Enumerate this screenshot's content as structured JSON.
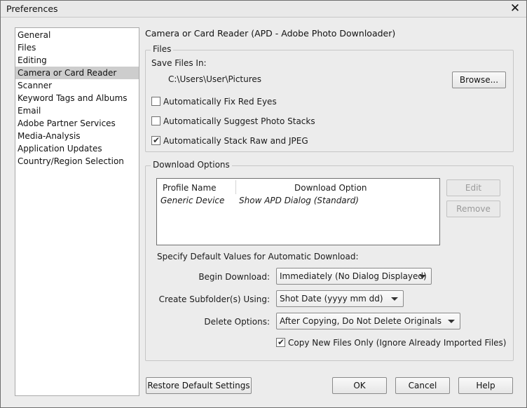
{
  "window": {
    "title": "Preferences"
  },
  "sidebar": {
    "items": [
      {
        "label": "General"
      },
      {
        "label": "Files"
      },
      {
        "label": "Editing"
      },
      {
        "label": "Camera or Card Reader",
        "selected": true
      },
      {
        "label": "Scanner"
      },
      {
        "label": "Keyword Tags and Albums"
      },
      {
        "label": "Email"
      },
      {
        "label": "Adobe Partner Services"
      },
      {
        "label": "Media-Analysis"
      },
      {
        "label": "Application Updates"
      },
      {
        "label": "Country/Region Selection"
      }
    ]
  },
  "page": {
    "title": "Camera or Card Reader (APD - Adobe Photo Downloader)"
  },
  "files": {
    "group_label": "Files",
    "save_label": "Save Files In:",
    "path": "C:\\Users\\User\\Pictures",
    "browse_label": "Browse...",
    "options": [
      {
        "label": "Automatically Fix Red Eyes",
        "checked": false
      },
      {
        "label": "Automatically Suggest Photo Stacks",
        "checked": false
      },
      {
        "label": "Automatically Stack Raw and JPEG",
        "checked": true
      }
    ]
  },
  "download": {
    "group_label": "Download Options",
    "columns": [
      "Profile Name",
      "Download Option"
    ],
    "rows": [
      {
        "profile": "Generic Device",
        "option": "Show APD Dialog (Standard)"
      }
    ],
    "edit_label": "Edit",
    "remove_label": "Remove",
    "defaults_label": "Specify Default Values for Automatic Download:",
    "begin_label": "Begin Download:",
    "begin_value": "Immediately (No Dialog Displayed)",
    "subfolder_label": "Create Subfolder(s) Using:",
    "subfolder_value": "Shot Date (yyyy mm dd)",
    "delete_label": "Delete Options:",
    "delete_value": "After Copying, Do Not Delete Originals",
    "copy_new_label": "Copy New Files Only (Ignore Already Imported Files)",
    "copy_new_checked": true
  },
  "footer": {
    "restore_label": "Restore Default Settings",
    "ok_label": "OK",
    "cancel_label": "Cancel",
    "help_label": "Help"
  },
  "icons": {
    "close": "close-icon",
    "check": "checkmark-icon",
    "dropdown": "chevron-down-icon"
  },
  "colors": {
    "selected_item": "#cdcdcd",
    "window_bg": "#ececec"
  }
}
